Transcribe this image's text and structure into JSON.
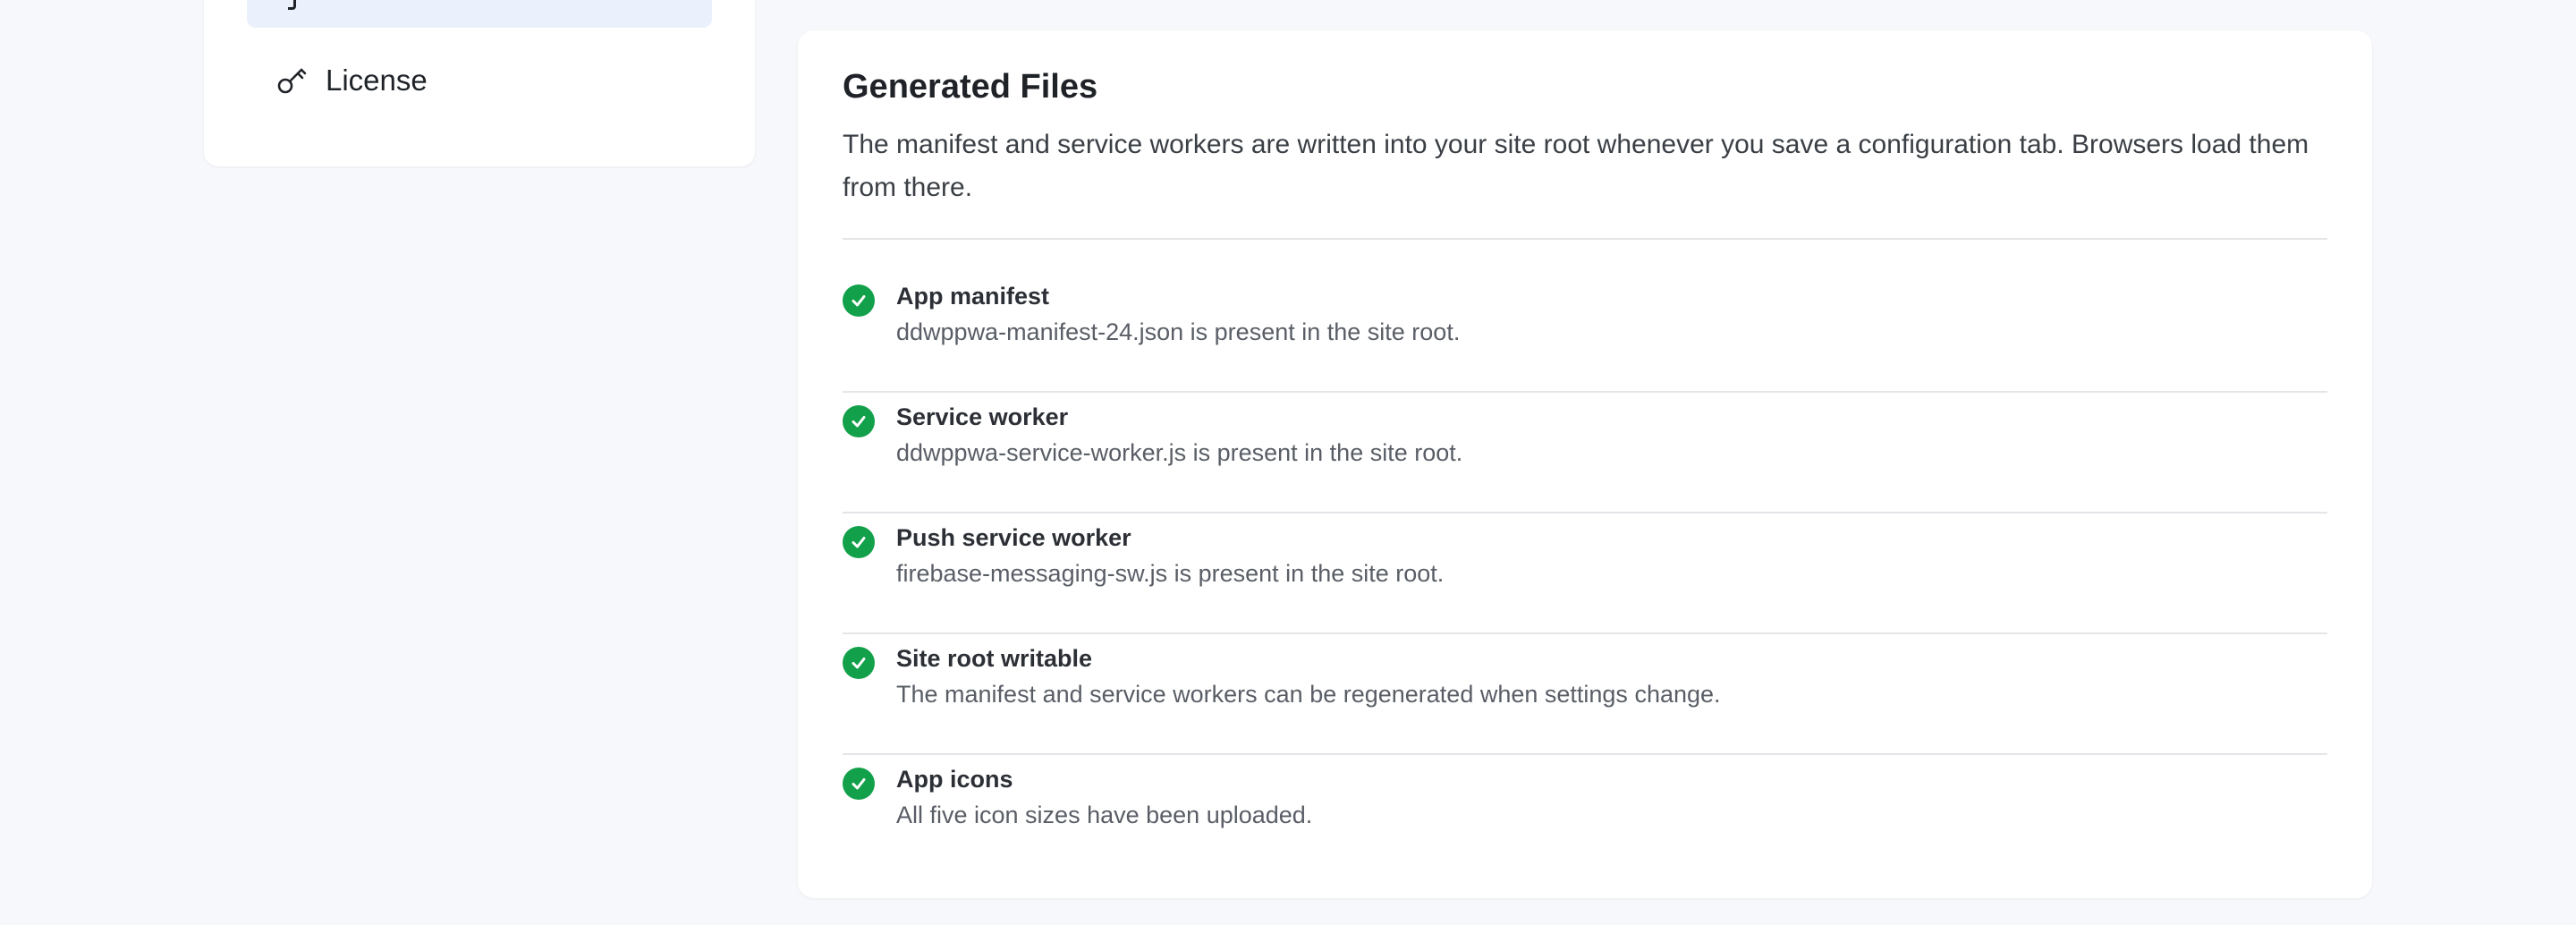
{
  "sidebar": {
    "items": [
      {
        "label": "License",
        "icon": "key-icon"
      }
    ]
  },
  "generated_files": {
    "title": "Generated Files",
    "description": "The manifest and service workers are written into your site root whenever you save a configuration tab. Browsers load them from there.",
    "status_color": "#12a04a",
    "checks": [
      {
        "title": "App manifest",
        "detail": "ddwppwa-manifest-24.json is present in the site root.",
        "status": "ok"
      },
      {
        "title": "Service worker",
        "detail": "ddwppwa-service-worker.js is present in the site root.",
        "status": "ok"
      },
      {
        "title": "Push service worker",
        "detail": "firebase-messaging-sw.js is present in the site root.",
        "status": "ok"
      },
      {
        "title": "Site root writable",
        "detail": "The manifest and service workers can be regenerated when settings change.",
        "status": "ok"
      },
      {
        "title": "App icons",
        "detail": "All five icon sizes have been uploaded.",
        "status": "ok"
      }
    ]
  }
}
